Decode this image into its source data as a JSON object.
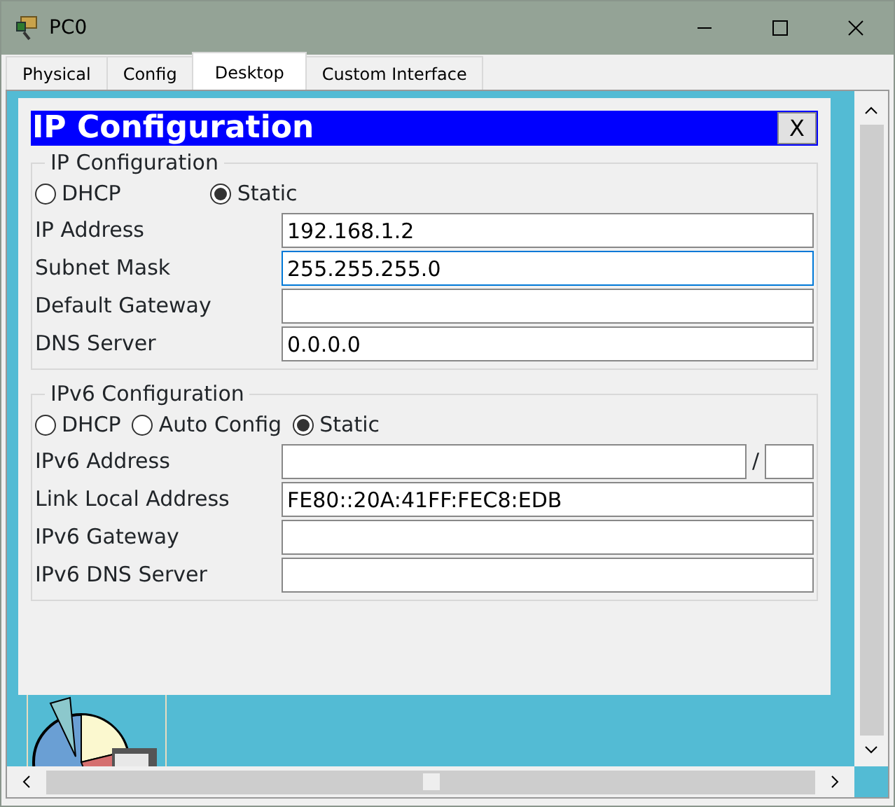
{
  "window": {
    "title": "PC0"
  },
  "tabs": [
    {
      "label": "Physical",
      "selected": false
    },
    {
      "label": "Config",
      "selected": false
    },
    {
      "label": "Desktop",
      "selected": true
    },
    {
      "label": "Custom Interface",
      "selected": false
    }
  ],
  "dialog": {
    "title": "IP Configuration",
    "close": "X",
    "sections": [
      {
        "legend": "IP Configuration",
        "modes": [
          {
            "label": "DHCP",
            "selected": false
          },
          {
            "label": "Static",
            "selected": true
          }
        ],
        "fields": [
          {
            "label": "IP Address",
            "value": "192.168.1.2",
            "focused": false
          },
          {
            "label": "Subnet Mask",
            "value": "255.255.255.0",
            "focused": true
          },
          {
            "label": "Default Gateway",
            "focused": false
          },
          {
            "label": "DNS Server",
            "value": "0.0.0.0",
            "focused": false
          }
        ]
      },
      {
        "legend": "IPv6 Configuration",
        "modes": [
          {
            "label": "DHCP",
            "selected": false
          },
          {
            "label": "Auto Config",
            "selected": false
          },
          {
            "label": "Static",
            "selected": true
          }
        ],
        "fields": [
          {
            "label": "IPv6 Address",
            "kind": "prefixed",
            "separator": "/",
            "focused": false
          },
          {
            "label": "Link Local Address",
            "value": "FE80::20A:41FF:FEC8:EDB",
            "focused": false
          },
          {
            "label": "IPv6 Gateway",
            "focused": false
          },
          {
            "label": "IPv6 DNS Server",
            "focused": false
          }
        ]
      }
    ]
  }
}
